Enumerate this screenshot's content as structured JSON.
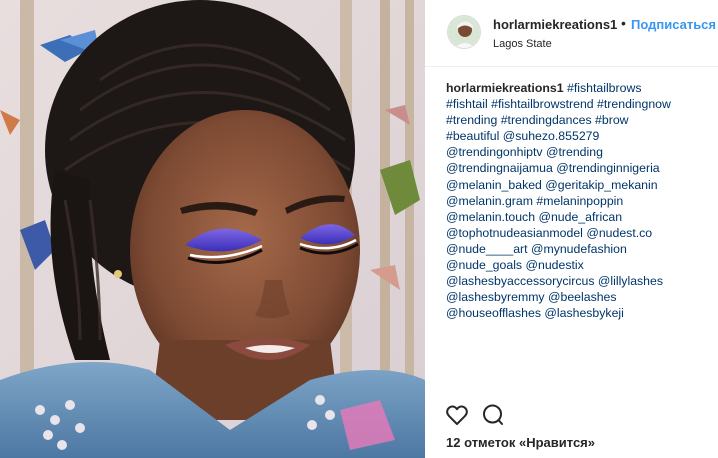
{
  "post": {
    "username": "horlarmiekreations1",
    "separator": "•",
    "follow_label": "Подписаться",
    "location": "Lagos State"
  },
  "caption": {
    "author": "horlarmiekreations1",
    "lines": [
      "#fishtailbrows",
      "#fishtail #fishtailbrowstrend #trendingnow",
      "#trending #trendingdances #brow",
      "#beautiful @suhezo.855279",
      "@trendingonhiptv @trending",
      "@trendingnaijamua @trendinginnigeria",
      "@melanin_baked @geritakip_mekanin",
      "@melanin.gram #melaninpoppin",
      "@melanin.touch @nude_african",
      "@tophotnudeasianmodel @nudest.co",
      "@nude____art @mynudefashion",
      "@nude_goals @nudestix",
      "@lashesbyaccessorycircus @lillylashes",
      "@lashesbyremmy @beelashes",
      "@houseofflashes @lashesbykeji"
    ]
  },
  "actions": {
    "like_icon": "heart-icon",
    "comment_icon": "comment-icon",
    "likes_text": "12 отметок «Нравится»"
  },
  "colors": {
    "link": "#003569",
    "follow": "#3897f0",
    "text": "#262626",
    "eyeshadow": "#5b3fd0"
  }
}
